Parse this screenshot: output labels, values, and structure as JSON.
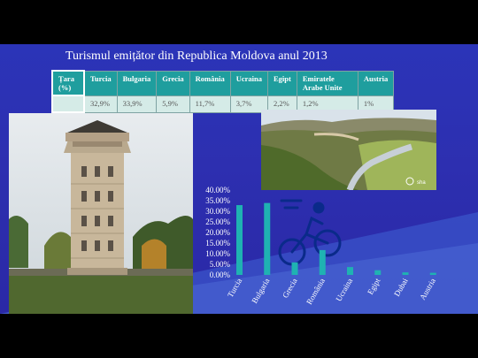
{
  "slide": {
    "title": "Turismul emițător din Republica Moldova anul 2013"
  },
  "table": {
    "header": [
      "Țara (%)",
      "Turcia",
      "Bulgaria",
      "Grecia",
      "România",
      "Ucraina",
      "Egipt",
      "Emiratele Arabe Unite",
      "Austria"
    ],
    "values": [
      "",
      "32,9%",
      "33,9%",
      "5,9%",
      "11,7%",
      "3,7%",
      "2,2%",
      "1,2%",
      "1%"
    ]
  },
  "images": {
    "water_tower": "water-tower-photo",
    "canyon": "river-canyon-photo",
    "watermark": "sha"
  },
  "chart_data": {
    "type": "bar",
    "categories": [
      "Turcia",
      "Bulgaria",
      "Grecia",
      "România",
      "Ucraina",
      "Egipt",
      "Dubai",
      "Austria"
    ],
    "values": [
      32.9,
      33.9,
      5.9,
      11.7,
      3.7,
      2.2,
      1.2,
      1.0
    ],
    "ylim": [
      0,
      40
    ],
    "yticks": [
      "0.00%",
      "5.00%",
      "10.00%",
      "15.00%",
      "20.00%",
      "25.00%",
      "30.00%",
      "35.00%",
      "40.00%"
    ],
    "bar_color": "#1fb2b2",
    "grid": false
  }
}
